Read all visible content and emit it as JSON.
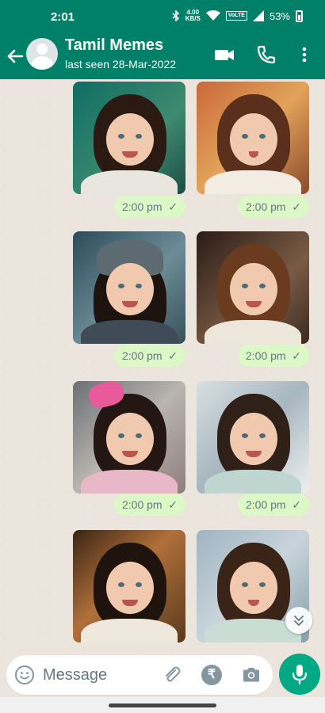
{
  "status_bar": {
    "time": "2:01",
    "network_speed_value": "4.00",
    "network_speed_unit": "KB/S",
    "volte": "VoLTE",
    "battery": "53%"
  },
  "header": {
    "contact_name": "Tamil Memes",
    "status": "last seen 28-Mar-2022"
  },
  "messages": [
    {
      "time": "2:00 pm",
      "tick": "✓"
    },
    {
      "time": "2:00 pm",
      "tick": "✓"
    },
    {
      "time": "2:00 pm",
      "tick": "✓"
    },
    {
      "time": "2:00 pm",
      "tick": "✓"
    },
    {
      "time": "2:00 pm",
      "tick": "✓"
    },
    {
      "time": "2:00 pm",
      "tick": "✓"
    }
  ],
  "composer": {
    "placeholder": "Message",
    "rupee_symbol": "₹"
  },
  "colors": {
    "header": "#008069",
    "accent": "#00a884",
    "timestamp_bubble": "#dcf8c6",
    "chat_background": "#ece5dd"
  },
  "icons": [
    "back-arrow-icon",
    "avatar-icon",
    "video-call-icon",
    "voice-call-icon",
    "more-vert-icon",
    "emoji-icon",
    "attach-icon",
    "rupee-icon",
    "camera-icon",
    "mic-icon",
    "scroll-down-icon"
  ]
}
